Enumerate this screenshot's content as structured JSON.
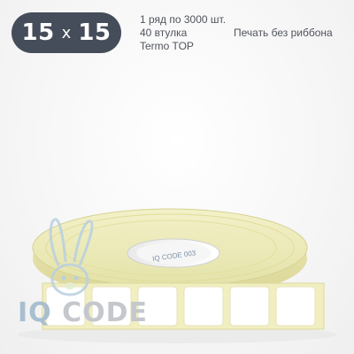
{
  "size_badge": {
    "width": "15",
    "separator": "x",
    "height": "15",
    "color": "#454d5a"
  },
  "info": {
    "line1": "1 ряд по 3000 шт.",
    "line2": "40 втулка",
    "line3": "Termo TOP",
    "print_mode": "Печать без риббона"
  },
  "product_image": {
    "core_print": "IQ CODE 003"
  },
  "watermark": {
    "brand_part1": "IQ",
    "brand_part2": "CODE",
    "mascot_icon": "rabbit-icon"
  }
}
